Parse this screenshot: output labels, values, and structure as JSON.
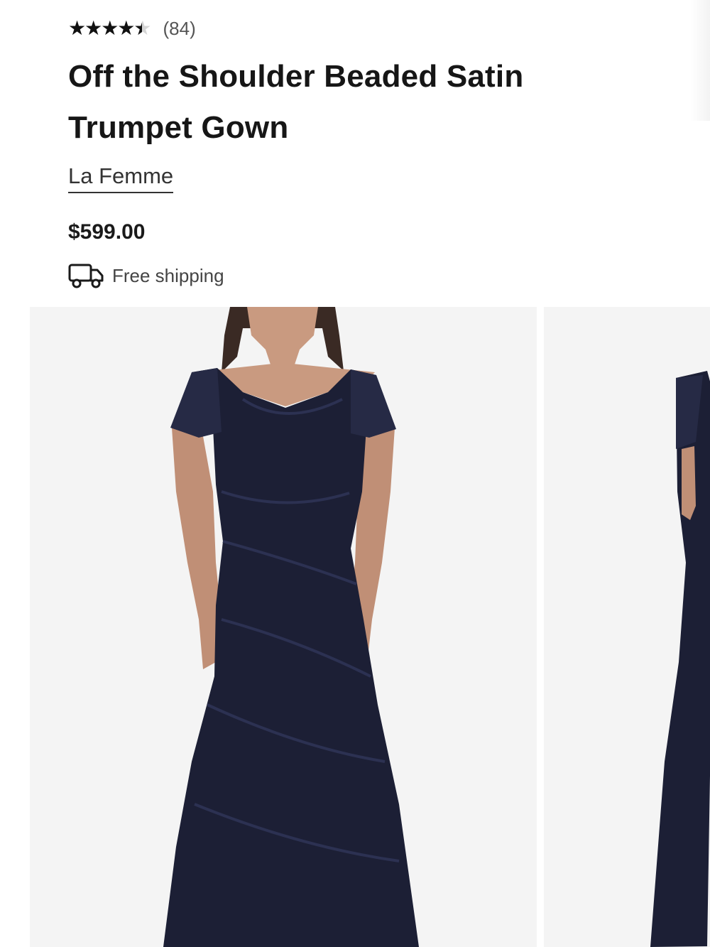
{
  "product": {
    "rating_stars": "★★★★★",
    "rating_value": 4.5,
    "rating_max": 5,
    "review_count": "(84)",
    "title": "Off the Shoulder Beaded Satin Trumpet Gown",
    "brand": "La Femme",
    "price": "$599.00",
    "shipping": "Free shipping",
    "shipping_icon": "truck-icon"
  },
  "gallery": {
    "photo_count_visible": 2,
    "photo_background": "#f4f4f4",
    "dress_color": "#1c1f35"
  },
  "colors": {
    "text": "#1a1a1a",
    "muted_text": "#555555",
    "star_filled": "#111111",
    "star_empty": "#d6d6d6"
  }
}
